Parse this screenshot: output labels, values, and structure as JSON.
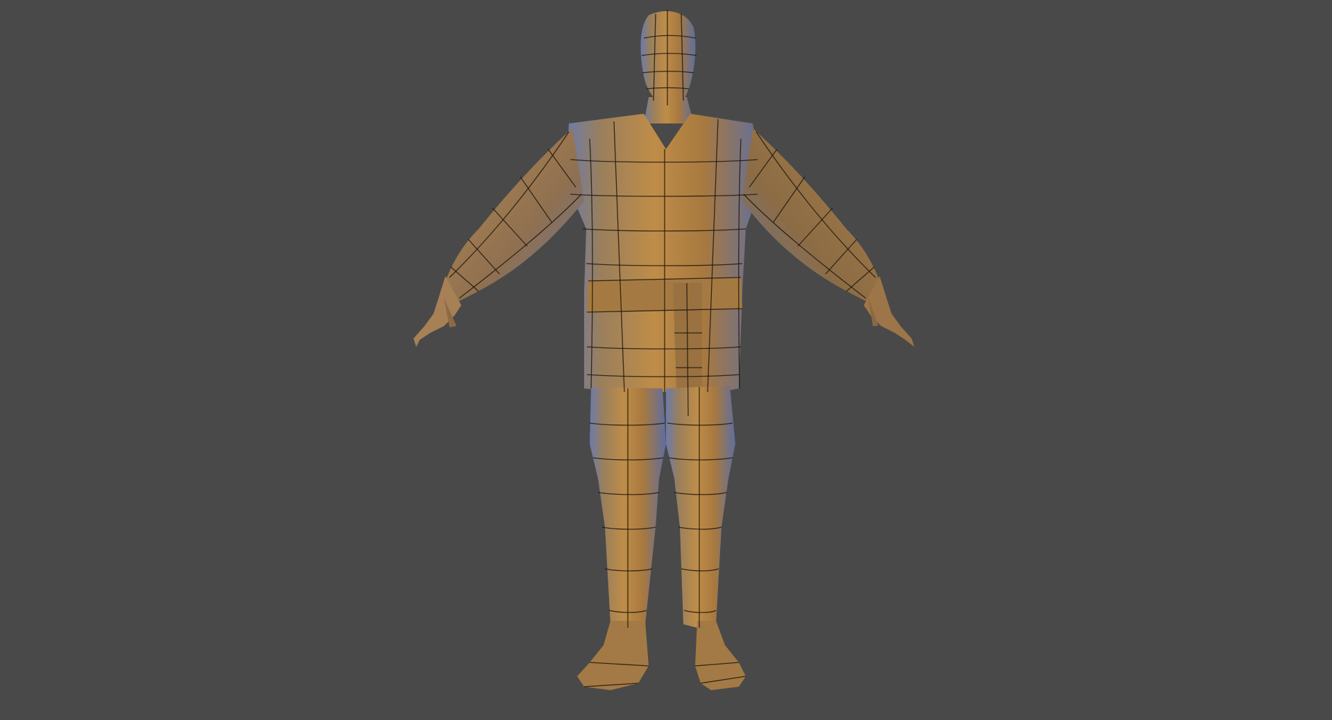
{
  "viewport": {
    "background_color": "#494949",
    "shading": "clay-wireframe",
    "model_base_color": "#b88a4a",
    "model_rim_color": "#6d7fb0",
    "wire_color": "#1e160c"
  }
}
